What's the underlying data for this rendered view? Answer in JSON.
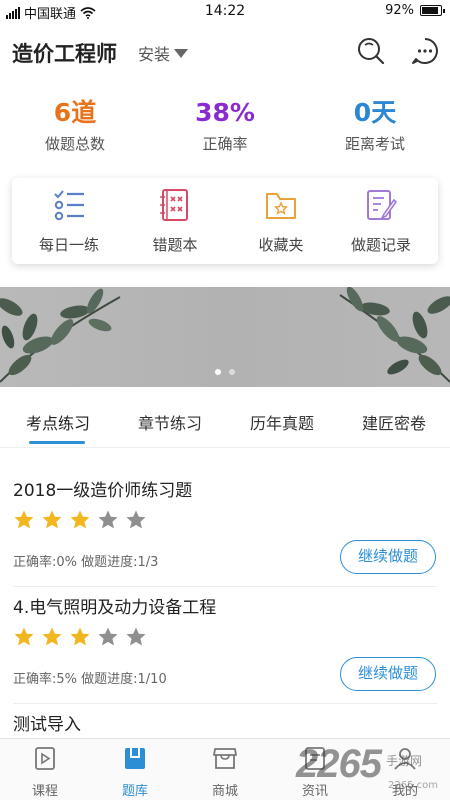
{
  "status_bar": {
    "carrier": "中国联通",
    "time": "14:22",
    "battery": "92%",
    "battery_level": 0.92
  },
  "header": {
    "title": "造价工程师",
    "dropdown": "安装",
    "search_icon": "search-icon",
    "message_icon": "chat-bubble-icon"
  },
  "stats": [
    {
      "value": "6道",
      "label": "做题总数",
      "color": "#e8731c"
    },
    {
      "value": "38%",
      "label": "正确率",
      "color": "#8a2bd1"
    },
    {
      "value": "0天",
      "label": "距离考试",
      "color": "#2b86d4"
    }
  ],
  "shortcuts": [
    {
      "label": "每日一练",
      "icon": "checklist-icon",
      "color": "#5b7ec9"
    },
    {
      "label": "错题本",
      "icon": "wrong-book-icon",
      "color": "#d64a66"
    },
    {
      "label": "收藏夹",
      "icon": "favorite-folder-icon",
      "color": "#e8a23a"
    },
    {
      "label": "做题记录",
      "icon": "record-edit-icon",
      "color": "#a17ad6"
    }
  ],
  "banner": {
    "slides": 2,
    "active_slide": 1
  },
  "tabs": [
    {
      "label": "考点练习",
      "active": true
    },
    {
      "label": "章节练习",
      "active": false
    },
    {
      "label": "历年真题",
      "active": false
    },
    {
      "label": "建匠密卷",
      "active": false
    }
  ],
  "courses": [
    {
      "title": "2018一级造价师练习题",
      "rating": 3,
      "max_rating": 5,
      "meta": "正确率:0%  做题进度:1/3",
      "button": "继续做题"
    },
    {
      "title": "4.电气照明及动力设备工程",
      "rating": 3,
      "max_rating": 5,
      "meta": "正确率:5%  做题进度:1/10",
      "button": "继续做题"
    },
    {
      "title": "测试导入"
    }
  ],
  "bottom_nav": [
    {
      "label": "课程",
      "icon": "course-play-icon",
      "active": false
    },
    {
      "label": "题库",
      "icon": "question-bank-icon",
      "active": true
    },
    {
      "label": "商城",
      "icon": "shop-icon",
      "active": false
    },
    {
      "label": "资讯",
      "icon": "news-icon",
      "active": false
    },
    {
      "label": "我的",
      "icon": "profile-icon",
      "active": false
    }
  ],
  "colors": {
    "accent": "#2c8fd6",
    "star_on": "#f2b61f",
    "star_off": "#8f8f8f"
  },
  "watermark": {
    "logo": "2265.com",
    "text": "手游网"
  }
}
